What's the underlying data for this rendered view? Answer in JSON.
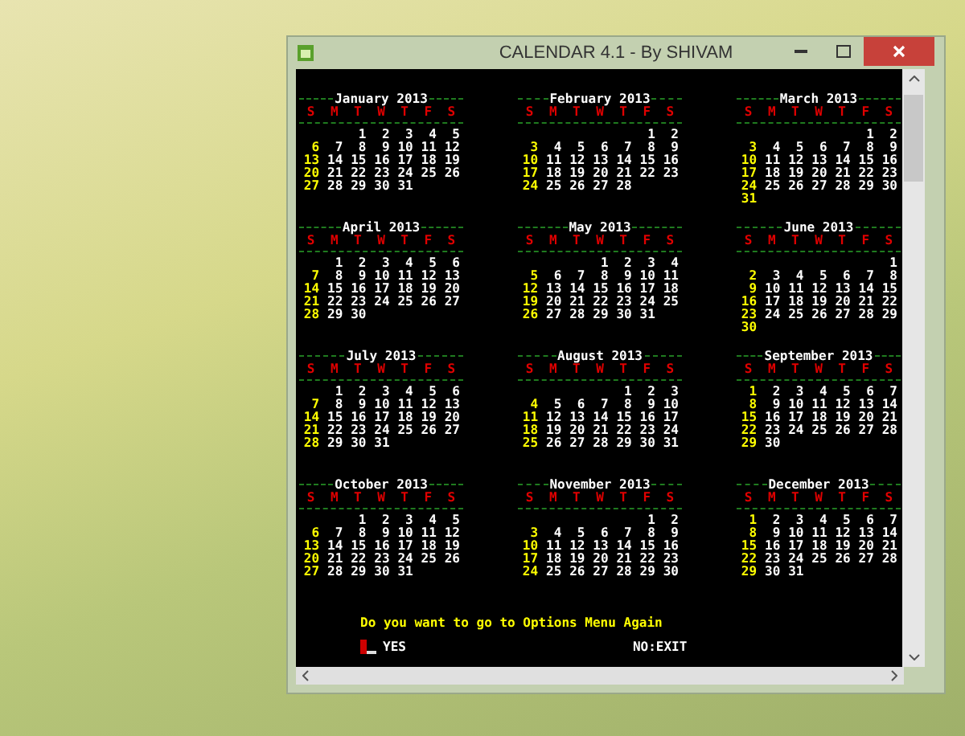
{
  "window": {
    "title": "CALENDAR 4.1 - By SHIVAM"
  },
  "months": [
    {
      "title": "January 2013",
      "weekdays": [
        "S",
        "M",
        "T",
        "W",
        "T",
        "F",
        "S"
      ],
      "weeks": [
        [
          "1",
          "2",
          "3",
          "4",
          "5"
        ],
        [
          "6",
          "7",
          "8",
          "9",
          "10",
          "11",
          "12"
        ],
        [
          "13",
          "14",
          "15",
          "16",
          "17",
          "18",
          "19"
        ],
        [
          "20",
          "21",
          "22",
          "23",
          "24",
          "25",
          "26"
        ],
        [
          "27",
          "28",
          "29",
          "30",
          "31"
        ]
      ]
    },
    {
      "title": "February 2013",
      "weekdays": [
        "S",
        "M",
        "T",
        "W",
        "T",
        "F",
        "S"
      ],
      "weeks": [
        [
          "1",
          "2"
        ],
        [
          "3",
          "4",
          "5",
          "6",
          "7",
          "8",
          "9"
        ],
        [
          "10",
          "11",
          "12",
          "13",
          "14",
          "15",
          "16"
        ],
        [
          "17",
          "18",
          "19",
          "20",
          "21",
          "22",
          "23"
        ],
        [
          "24",
          "25",
          "26",
          "27",
          "28"
        ]
      ]
    },
    {
      "title": "March 2013",
      "weekdays": [
        "S",
        "M",
        "T",
        "W",
        "T",
        "F",
        "S"
      ],
      "weeks": [
        [
          "1",
          "2"
        ],
        [
          "3",
          "4",
          "5",
          "6",
          "7",
          "8",
          "9"
        ],
        [
          "10",
          "11",
          "12",
          "13",
          "14",
          "15",
          "16"
        ],
        [
          "17",
          "18",
          "19",
          "20",
          "21",
          "22",
          "23"
        ],
        [
          "24",
          "25",
          "26",
          "27",
          "28",
          "29",
          "30"
        ],
        [
          "31"
        ]
      ]
    },
    {
      "title": "April 2013",
      "weekdays": [
        "S",
        "M",
        "T",
        "W",
        "T",
        "F",
        "S"
      ],
      "weeks": [
        [
          "1",
          "2",
          "3",
          "4",
          "5",
          "6"
        ],
        [
          "7",
          "8",
          "9",
          "10",
          "11",
          "12",
          "13"
        ],
        [
          "14",
          "15",
          "16",
          "17",
          "18",
          "19",
          "20"
        ],
        [
          "21",
          "22",
          "23",
          "24",
          "25",
          "26",
          "27"
        ],
        [
          "28",
          "29",
          "30"
        ]
      ]
    },
    {
      "title": "May 2013",
      "weekdays": [
        "S",
        "M",
        "T",
        "W",
        "T",
        "F",
        "S"
      ],
      "weeks": [
        [
          "1",
          "2",
          "3",
          "4"
        ],
        [
          "5",
          "6",
          "7",
          "8",
          "9",
          "10",
          "11"
        ],
        [
          "12",
          "13",
          "14",
          "15",
          "16",
          "17",
          "18"
        ],
        [
          "19",
          "20",
          "21",
          "22",
          "23",
          "24",
          "25"
        ],
        [
          "26",
          "27",
          "28",
          "29",
          "30",
          "31"
        ]
      ]
    },
    {
      "title": "June 2013",
      "weekdays": [
        "S",
        "M",
        "T",
        "W",
        "T",
        "F",
        "S"
      ],
      "weeks": [
        [
          "1"
        ],
        [
          "2",
          "3",
          "4",
          "5",
          "6",
          "7",
          "8"
        ],
        [
          "9",
          "10",
          "11",
          "12",
          "13",
          "14",
          "15"
        ],
        [
          "16",
          "17",
          "18",
          "19",
          "20",
          "21",
          "22"
        ],
        [
          "23",
          "24",
          "25",
          "26",
          "27",
          "28",
          "29"
        ],
        [
          "30"
        ]
      ]
    },
    {
      "title": "July 2013",
      "weekdays": [
        "S",
        "M",
        "T",
        "W",
        "T",
        "F",
        "S"
      ],
      "weeks": [
        [
          "1",
          "2",
          "3",
          "4",
          "5",
          "6"
        ],
        [
          "7",
          "8",
          "9",
          "10",
          "11",
          "12",
          "13"
        ],
        [
          "14",
          "15",
          "16",
          "17",
          "18",
          "19",
          "20"
        ],
        [
          "21",
          "22",
          "23",
          "24",
          "25",
          "26",
          "27"
        ],
        [
          "28",
          "29",
          "30",
          "31"
        ]
      ]
    },
    {
      "title": "August 2013",
      "weekdays": [
        "S",
        "M",
        "T",
        "W",
        "T",
        "F",
        "S"
      ],
      "weeks": [
        [
          "1",
          "2",
          "3"
        ],
        [
          "4",
          "5",
          "6",
          "7",
          "8",
          "9",
          "10"
        ],
        [
          "11",
          "12",
          "13",
          "14",
          "15",
          "16",
          "17"
        ],
        [
          "18",
          "19",
          "20",
          "21",
          "22",
          "23",
          "24"
        ],
        [
          "25",
          "26",
          "27",
          "28",
          "29",
          "30",
          "31"
        ]
      ]
    },
    {
      "title": "September 2013",
      "weekdays": [
        "S",
        "M",
        "T",
        "W",
        "T",
        "F",
        "S"
      ],
      "weeks": [
        [
          "1",
          "2",
          "3",
          "4",
          "5",
          "6",
          "7"
        ],
        [
          "8",
          "9",
          "10",
          "11",
          "12",
          "13",
          "14"
        ],
        [
          "15",
          "16",
          "17",
          "18",
          "19",
          "20",
          "21"
        ],
        [
          "22",
          "23",
          "24",
          "25",
          "26",
          "27",
          "28"
        ],
        [
          "29",
          "30"
        ]
      ]
    },
    {
      "title": "October 2013",
      "weekdays": [
        "S",
        "M",
        "T",
        "W",
        "T",
        "F",
        "S"
      ],
      "weeks": [
        [
          "1",
          "2",
          "3",
          "4",
          "5"
        ],
        [
          "6",
          "7",
          "8",
          "9",
          "10",
          "11",
          "12"
        ],
        [
          "13",
          "14",
          "15",
          "16",
          "17",
          "18",
          "19"
        ],
        [
          "20",
          "21",
          "22",
          "23",
          "24",
          "25",
          "26"
        ],
        [
          "27",
          "28",
          "29",
          "30",
          "31"
        ]
      ]
    },
    {
      "title": "November 2013",
      "weekdays": [
        "S",
        "M",
        "T",
        "W",
        "T",
        "F",
        "S"
      ],
      "weeks": [
        [
          "1",
          "2"
        ],
        [
          "3",
          "4",
          "5",
          "6",
          "7",
          "8",
          "9"
        ],
        [
          "10",
          "11",
          "12",
          "13",
          "14",
          "15",
          "16"
        ],
        [
          "17",
          "18",
          "19",
          "20",
          "21",
          "22",
          "23"
        ],
        [
          "24",
          "25",
          "26",
          "27",
          "28",
          "29",
          "30"
        ]
      ]
    },
    {
      "title": "December 2013",
      "weekdays": [
        "S",
        "M",
        "T",
        "W",
        "T",
        "F",
        "S"
      ],
      "weeks": [
        [
          "1",
          "2",
          "3",
          "4",
          "5",
          "6",
          "7"
        ],
        [
          "8",
          "9",
          "10",
          "11",
          "12",
          "13",
          "14"
        ],
        [
          "15",
          "16",
          "17",
          "18",
          "19",
          "20",
          "21"
        ],
        [
          "22",
          "23",
          "24",
          "25",
          "26",
          "27",
          "28"
        ],
        [
          "29",
          "30",
          "31"
        ]
      ]
    }
  ],
  "prompt": {
    "question": "Do you want to go to Options Menu Again",
    "yes_label": "YES",
    "no_label": "NO:EXIT"
  }
}
